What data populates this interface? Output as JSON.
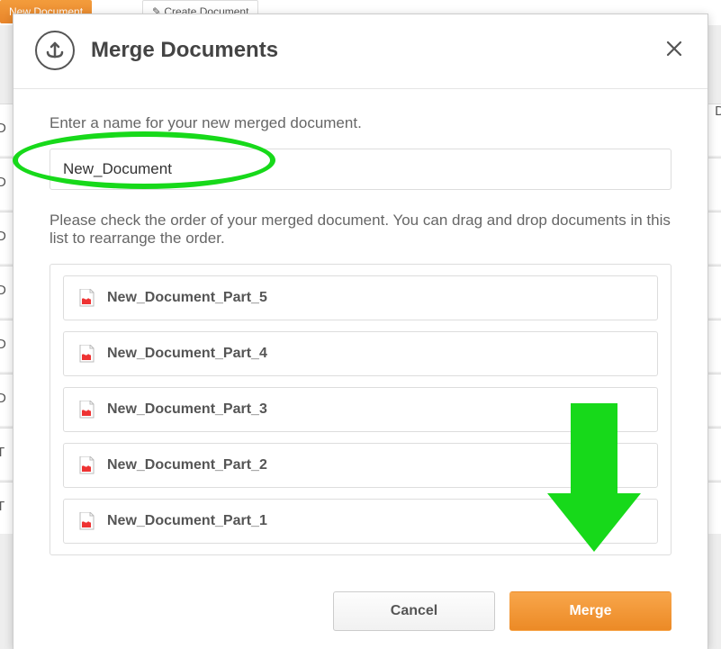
{
  "background": {
    "new_doc_btn": "New Document",
    "create_btn": "Create Document"
  },
  "modal": {
    "title": "Merge Documents",
    "name_label": "Enter a name for your new merged document.",
    "name_value": "New_Document",
    "order_label": "Please check the order of your merged document. You can drag and drop documents in this list to rearrange the order.",
    "items": [
      {
        "label": "New_Document_Part_5"
      },
      {
        "label": "New_Document_Part_4"
      },
      {
        "label": "New_Document_Part_3"
      },
      {
        "label": "New_Document_Part_2"
      },
      {
        "label": "New_Document_Part_1"
      }
    ],
    "cancel_label": "Cancel",
    "merge_label": "Merge"
  }
}
